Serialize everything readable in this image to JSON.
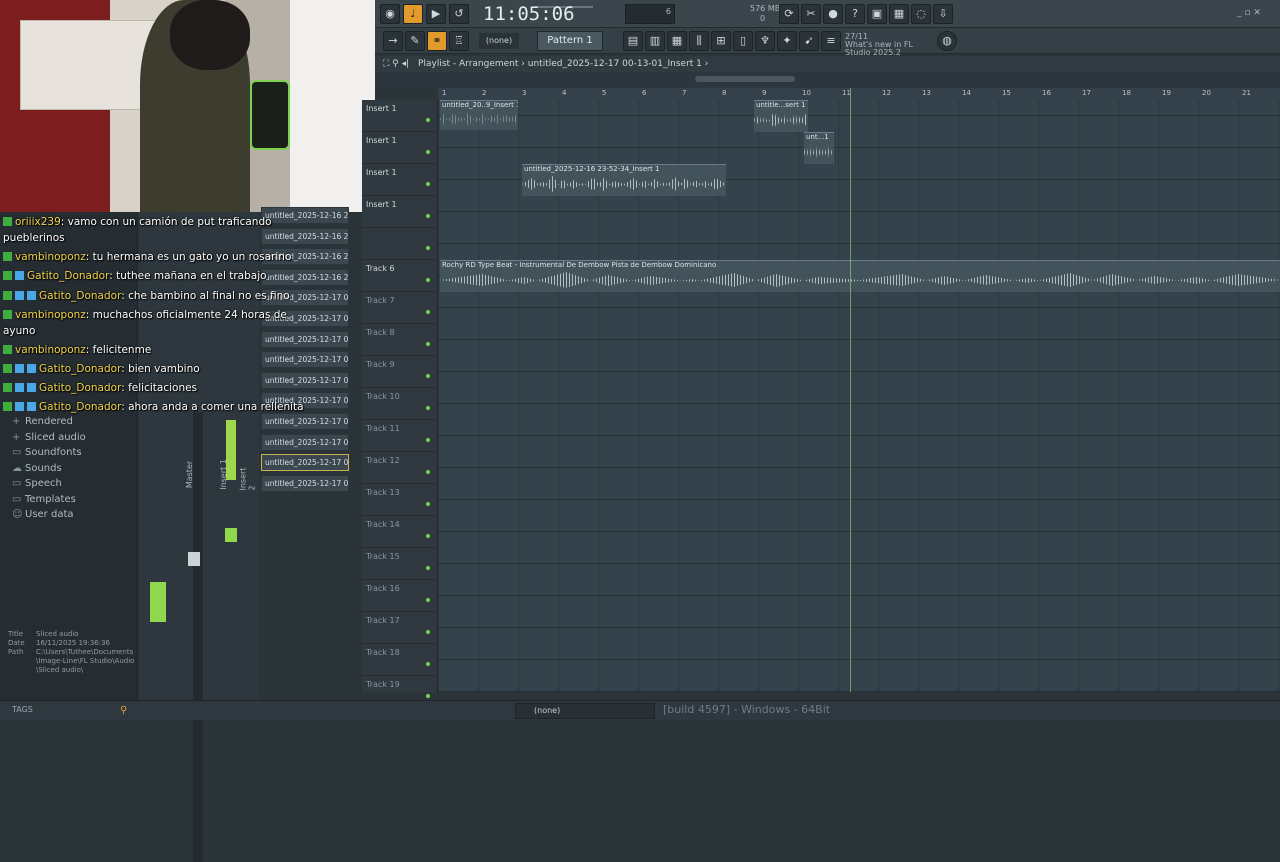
{
  "toolbar": {
    "time": "11:05:06",
    "tempo_small": "6",
    "mem": "576 MB",
    "mem2": "0",
    "pattern_name": "(none)",
    "pattern": "Pattern 1",
    "news_date": "27/11",
    "news_text": "What's new in FL Studio 2025.2"
  },
  "playlist": {
    "title": "Playlist - Arrangement",
    "path": "untitled_2025-12-17 00-13-01_Insert 1",
    "ruler": [
      "1",
      "2",
      "3",
      "4",
      "5",
      "6",
      "7",
      "8",
      "9",
      "10",
      "11",
      "12",
      "13",
      "14",
      "15",
      "16",
      "17",
      "18",
      "19",
      "20",
      "21"
    ],
    "tracks": [
      "Insert 1",
      "Insert 1",
      "Insert 1",
      "Insert 1",
      "",
      "Track 6",
      "Track 7",
      "Track 8",
      "Track 9",
      "Track 10",
      "Track 11",
      "Track 12",
      "Track 13",
      "Track 14",
      "Track 15",
      "Track 16",
      "Track 17",
      "Track 18",
      "Track 19"
    ],
    "clips": [
      {
        "label": "untitled_20..9_Insert 1"
      },
      {
        "label": "untitle...sert 1"
      },
      {
        "label": "unt...1"
      },
      {
        "label": "untitled_2025-12-16 23-52-34_Insert 1"
      },
      {
        "label": "Rochy RD Type Beat - Instrumental De Dembow  Pista de Dembow Dominicano"
      }
    ]
  },
  "browser": {
    "items": [
      {
        "label": "Rendered",
        "icon": "plus-icon"
      },
      {
        "label": "Sliced audio",
        "icon": "plus-icon"
      },
      {
        "label": "Soundfonts",
        "icon": "folder-icon"
      },
      {
        "label": "Sounds",
        "icon": "cloud-icon"
      },
      {
        "label": "Speech",
        "icon": "folder-icon"
      },
      {
        "label": "Templates",
        "icon": "folder-icon"
      },
      {
        "label": "User data",
        "icon": "person-icon"
      }
    ],
    "info_title_label": "Title",
    "info_title": "Sliced audio",
    "info_date_label": "Date",
    "info_date": "16/11/2025 19:36:36",
    "info_path_label": "Path",
    "info_path": "C:\\Users\\Tuthee\\Documents\\Image-Line\\FL Studio\\Audio\\Sliced audio\\",
    "tags_label": "TAGS"
  },
  "files": [
    "untitled_2025-12-16 23-...",
    "untitled_2025-12-16 23-...",
    "untitled_2025-12-16 23-...",
    "untitled_2025-12-16 23-...",
    "untitled_2025-12-17 00-...",
    "untitled_2025-12-17 00-...",
    "untitled_2025-12-17 00-...",
    "untitled_2025-12-17 00-...",
    "untitled_2025-12-17 00-...",
    "untitled_2025-12-17 00-...",
    "untitled_2025-12-17 00-...",
    "untitled_2025-12-17 00-...",
    "untitled_2025-12-17 00-...",
    "untitled_2025-12-17 00-..."
  ],
  "chat": [
    {
      "user": "oriiix239",
      "text": ": vamo con un camión de put traficando",
      "badges": 1
    },
    {
      "user": "",
      "text": "pueblerinos",
      "badges": 0
    },
    {
      "user": "vambinoponz",
      "text": ": tu hermana es un gato yo un rosarino",
      "badges": 1
    },
    {
      "user": "Gatito_Donador",
      "text": ": tuthee mañana en el trabajo",
      "badges": 2
    },
    {
      "user": "Gatito_Donador",
      "text": ": che bambino al final no es fino",
      "badges": 3
    },
    {
      "user": "vambinoponz",
      "text": ": muchachos oficialmente 24 horas de",
      "badges": 1
    },
    {
      "user": "",
      "text": "ayuno",
      "badges": 0
    },
    {
      "user": "vambinoponz",
      "text": ": felicitenme",
      "badges": 1
    },
    {
      "user": "Gatito_Donador",
      "text": ": bien vambino",
      "badges": 3
    },
    {
      "user": "Gatito_Donador",
      "text": ": felicitaciones",
      "badges": 3
    },
    {
      "user": "Gatito_Donador",
      "text": ": ahora anda a comer una rellenita",
      "badges": 3
    }
  ],
  "mixer": {
    "ch1": "Master",
    "ch2": "Insert 1",
    "ch3": "Insert 2"
  },
  "bottom": {
    "pattern_select": "(none)",
    "status": "[build 4597] - Windows - 64Bit"
  }
}
